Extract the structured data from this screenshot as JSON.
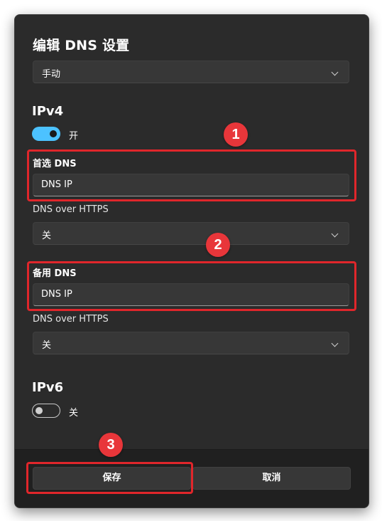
{
  "dialog": {
    "title": "编辑 DNS 设置",
    "mode_select": {
      "value": "手动"
    }
  },
  "ipv4": {
    "heading": "IPv4",
    "toggle": {
      "state": "on",
      "label": "开"
    },
    "preferred_dns": {
      "label": "首选 DNS",
      "value": "DNS IP",
      "doh_label": "DNS over HTTPS",
      "doh_value": "关"
    },
    "alternate_dns": {
      "label": "备用 DNS",
      "value": "DNS IP",
      "doh_label": "DNS over HTTPS",
      "doh_value": "关"
    }
  },
  "ipv6": {
    "heading": "IPv6",
    "toggle": {
      "state": "off",
      "label": "关"
    }
  },
  "footer": {
    "save_label": "保存",
    "cancel_label": "取消"
  },
  "annotations": {
    "badge_1": "1",
    "badge_2": "2",
    "badge_3": "3",
    "highlight_color": "#e0262b",
    "badge_color": "#e8363a"
  },
  "colors": {
    "dialog_bg": "#2b2b2b",
    "control_bg": "#373737",
    "accent": "#4cc2ff",
    "footer_bg": "#202020"
  }
}
